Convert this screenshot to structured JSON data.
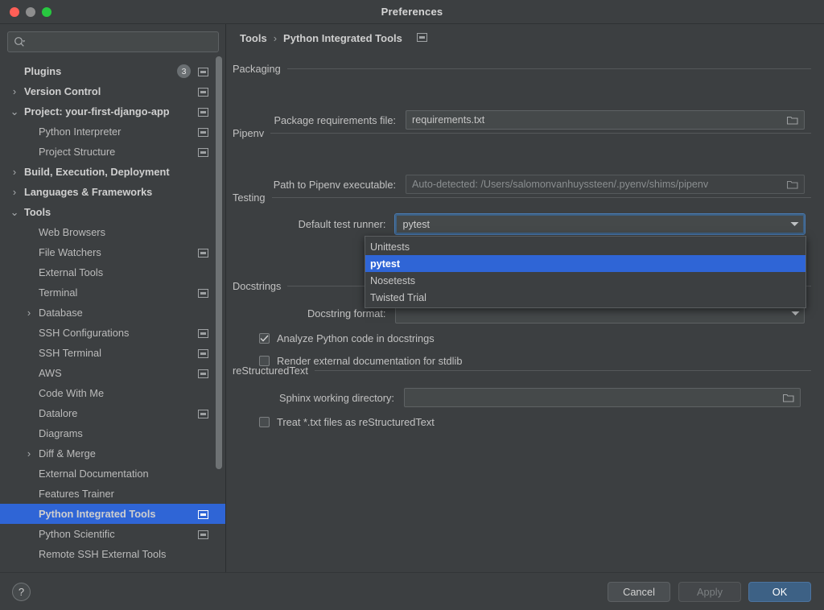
{
  "window": {
    "title": "Preferences",
    "traffic_lights": [
      "close-button",
      "minimize-button",
      "zoom-button"
    ]
  },
  "sidebar": {
    "search": {
      "value": "",
      "placeholder": ""
    },
    "items": [
      {
        "label": "Plugins",
        "indent": 30,
        "bold": true,
        "arrow": "",
        "badge": "3",
        "chip": true
      },
      {
        "label": "Version Control",
        "indent": 30,
        "bold": true,
        "arrow": "›",
        "badge": "",
        "chip": true
      },
      {
        "label": "Project: your-first-django-app",
        "indent": 30,
        "bold": true,
        "arrow": "⌄",
        "badge": "",
        "chip": true
      },
      {
        "label": "Python Interpreter",
        "indent": 48,
        "bold": false,
        "arrow": "",
        "badge": "",
        "chip": true
      },
      {
        "label": "Project Structure",
        "indent": 48,
        "bold": false,
        "arrow": "",
        "badge": "",
        "chip": true
      },
      {
        "label": "Build, Execution, Deployment",
        "indent": 30,
        "bold": true,
        "arrow": "›",
        "badge": "",
        "chip": false
      },
      {
        "label": "Languages & Frameworks",
        "indent": 30,
        "bold": true,
        "arrow": "›",
        "badge": "",
        "chip": false
      },
      {
        "label": "Tools",
        "indent": 30,
        "bold": true,
        "arrow": "⌄",
        "badge": "",
        "chip": false
      },
      {
        "label": "Web Browsers",
        "indent": 48,
        "bold": false,
        "arrow": "",
        "badge": "",
        "chip": false
      },
      {
        "label": "File Watchers",
        "indent": 48,
        "bold": false,
        "arrow": "",
        "badge": "",
        "chip": true
      },
      {
        "label": "External Tools",
        "indent": 48,
        "bold": false,
        "arrow": "",
        "badge": "",
        "chip": false
      },
      {
        "label": "Terminal",
        "indent": 48,
        "bold": false,
        "arrow": "",
        "badge": "",
        "chip": true
      },
      {
        "label": "Database",
        "indent": 48,
        "bold": false,
        "arrow": "›",
        "badge": "",
        "chip": false
      },
      {
        "label": "SSH Configurations",
        "indent": 48,
        "bold": false,
        "arrow": "",
        "badge": "",
        "chip": true
      },
      {
        "label": "SSH Terminal",
        "indent": 48,
        "bold": false,
        "arrow": "",
        "badge": "",
        "chip": true
      },
      {
        "label": "AWS",
        "indent": 48,
        "bold": false,
        "arrow": "",
        "badge": "",
        "chip": true
      },
      {
        "label": "Code With Me",
        "indent": 48,
        "bold": false,
        "arrow": "",
        "badge": "",
        "chip": false
      },
      {
        "label": "Datalore",
        "indent": 48,
        "bold": false,
        "arrow": "",
        "badge": "",
        "chip": true
      },
      {
        "label": "Diagrams",
        "indent": 48,
        "bold": false,
        "arrow": "",
        "badge": "",
        "chip": false
      },
      {
        "label": "Diff & Merge",
        "indent": 48,
        "bold": false,
        "arrow": "›",
        "badge": "",
        "chip": false
      },
      {
        "label": "External Documentation",
        "indent": 48,
        "bold": false,
        "arrow": "",
        "badge": "",
        "chip": false
      },
      {
        "label": "Features Trainer",
        "indent": 48,
        "bold": false,
        "arrow": "",
        "badge": "",
        "chip": false
      },
      {
        "label": "Python Integrated Tools",
        "indent": 48,
        "bold": true,
        "arrow": "",
        "badge": "",
        "chip": true,
        "selected": true
      },
      {
        "label": "Python Scientific",
        "indent": 48,
        "bold": false,
        "arrow": "",
        "badge": "",
        "chip": true
      },
      {
        "label": "Remote SSH External Tools",
        "indent": 48,
        "bold": false,
        "arrow": "",
        "badge": "",
        "chip": false
      }
    ]
  },
  "main": {
    "breadcrumb": {
      "parent": "Tools",
      "separator": "›",
      "current": "Python Integrated Tools"
    },
    "packaging": {
      "title": "Packaging",
      "requirements_label": "Package requirements file:",
      "requirements_value": "requirements.txt"
    },
    "pipenv": {
      "title": "Pipenv",
      "path_label": "Path to Pipenv executable:",
      "path_placeholder": "Auto-detected: /Users/salomonvanhuyssteen/.pyenv/shims/pipenv"
    },
    "testing": {
      "title": "Testing",
      "runner_label": "Default test runner:",
      "runner_value": "pytest",
      "runner_options": [
        "Unittests",
        "pytest",
        "Nosetests",
        "Twisted Trial"
      ],
      "runner_selected_index": 1
    },
    "docstrings": {
      "title": "Docstrings",
      "format_label": "Docstring format:",
      "format_value": "",
      "analyze_label": "Analyze Python code in docstrings",
      "analyze_checked": true,
      "render_label": "Render external documentation for stdlib",
      "render_checked": false
    },
    "restructuredtext": {
      "title": "reStructuredText",
      "sphinx_label": "Sphinx working directory:",
      "sphinx_value": "",
      "treat_txt_label": "Treat *.txt files as reStructuredText",
      "treat_txt_checked": false
    }
  },
  "footer": {
    "help_label": "?",
    "cancel_label": "Cancel",
    "apply_label": "Apply",
    "ok_label": "OK"
  },
  "colors": {
    "window_bg": "#3c3f41",
    "accent_selection": "#2f65d6",
    "primary_button": "#3d6185",
    "field_bg": "#45494a",
    "text": "#c2c2c2"
  }
}
